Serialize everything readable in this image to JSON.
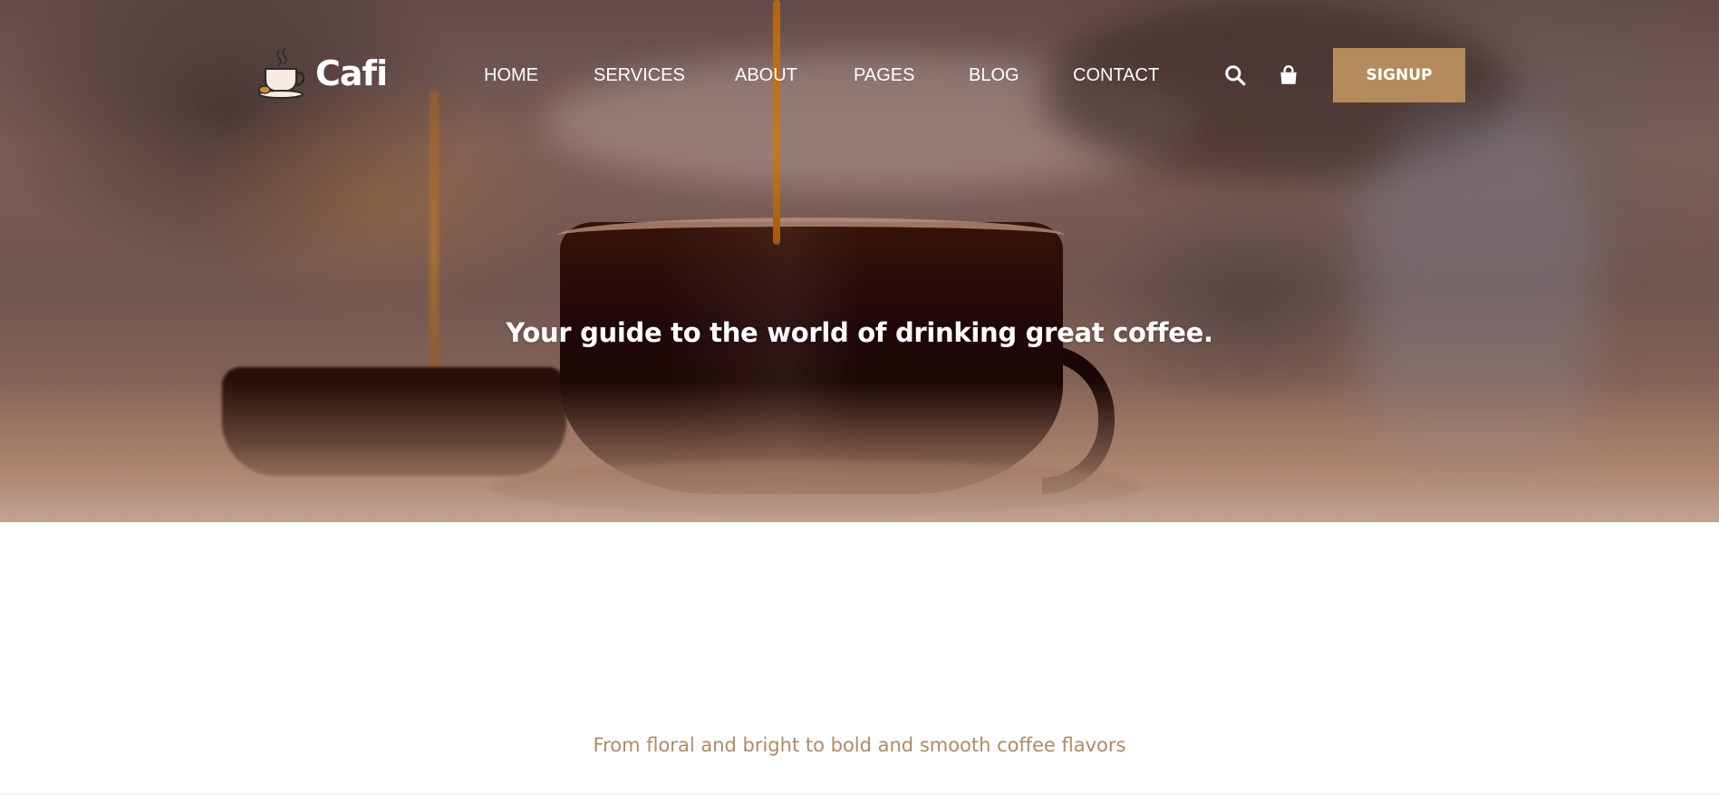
{
  "brand": {
    "name": "Cafi",
    "logo_icon": "coffee-cup-icon"
  },
  "nav": {
    "items": [
      {
        "label": "HOME"
      },
      {
        "label": "SERVICES"
      },
      {
        "label": "ABOUT"
      },
      {
        "label": "PAGES"
      },
      {
        "label": "BLOG"
      },
      {
        "label": "CONTACT"
      }
    ]
  },
  "header_actions": {
    "search_icon": "search-icon",
    "cart_icon": "shopping-bag-icon",
    "signup_label": "SIGNUP"
  },
  "hero": {
    "title": "Your guide to the world of drinking great coffee."
  },
  "intro": {
    "tagline": "From floral and bright to bold and smooth coffee flavors"
  },
  "colors": {
    "accent": "#b48b5d",
    "tagline": "#b08a63",
    "nav_text": "#ffffff"
  }
}
